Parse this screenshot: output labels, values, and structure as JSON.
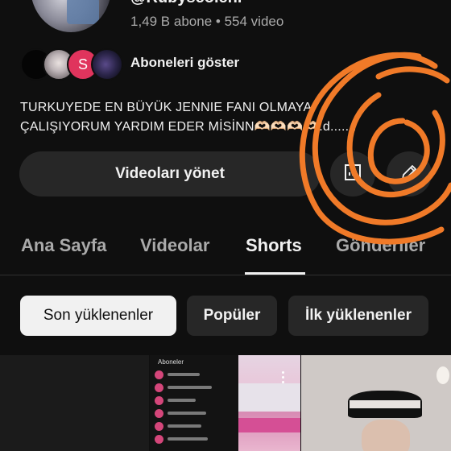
{
  "channel": {
    "handle": "@Rubyseoleni",
    "subscribers": "1,49 B abone",
    "separator": "•",
    "videos": "554 video",
    "show_subscribers": "Aboneleri göster",
    "subscriber_avatar_letter": "S",
    "bio_line1": "TURKUYEDE EN BÜYÜK JENNIE FANI OLMAYA",
    "bio_line2": "ÇALIŞIYORUM YARDIM EDER MİSİNN🫶🏻🫶🏻🫶🏻🫶🏻.d......."
  },
  "actions": {
    "manage_videos": "Videoları yönet"
  },
  "tabs": [
    {
      "label": "Ana Sayfa",
      "active": false
    },
    {
      "label": "Videolar",
      "active": false
    },
    {
      "label": "Shorts",
      "active": true
    },
    {
      "label": "Gönderiler",
      "active": false
    }
  ],
  "chips": [
    {
      "label": "Son yüklenenler",
      "selected": true
    },
    {
      "label": "Popüler",
      "selected": false
    },
    {
      "label": "İlk yüklenenler",
      "selected": false
    }
  ],
  "shorts": [
    {
      "overlay_text": "Aboneler"
    },
    {},
    {}
  ],
  "colors": {
    "background": "#0f0f0f",
    "button_bg": "#272727",
    "selected_chip": "#f1f1f1",
    "annotation_scribble": "#f07a28"
  }
}
